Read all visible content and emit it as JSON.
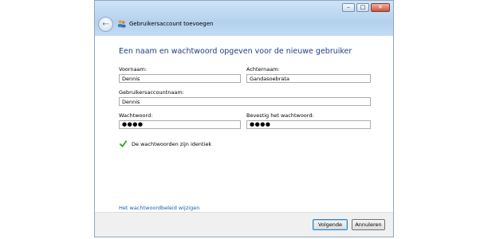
{
  "window": {
    "title": "Gebruikersaccount toevoegen",
    "caption": {
      "minimize": "–",
      "maximize": "□",
      "close": "✕"
    }
  },
  "heading": "Een naam en wachtwoord opgeven voor de nieuwe gebruiker",
  "form": {
    "first_name_label": "Voornaam:",
    "first_name_value": "Dennis",
    "last_name_label": "Achternaam:",
    "last_name_value": "Gandasoebrata",
    "username_label": "Gebruikersaccountnaam:",
    "username_value": "Dennis",
    "password_label": "Wachtwoord:",
    "password_value": "●●●●",
    "confirm_label": "Bevestig het wachtwoord:",
    "confirm_value": "●●●●"
  },
  "validation": {
    "match_message": "De wachtwoorden zijn identiek"
  },
  "policy_link": "Het wachtwoordbeleid wijzigen",
  "buttons": {
    "next": "Volgende",
    "cancel": "Annuleren"
  },
  "colors": {
    "heading": "#1e3d8c",
    "link": "#1a5fb4",
    "check": "#3a9a2a"
  },
  "icons": {
    "back": "back-arrow-icon",
    "app": "users-icon",
    "check": "checkmark-icon"
  }
}
